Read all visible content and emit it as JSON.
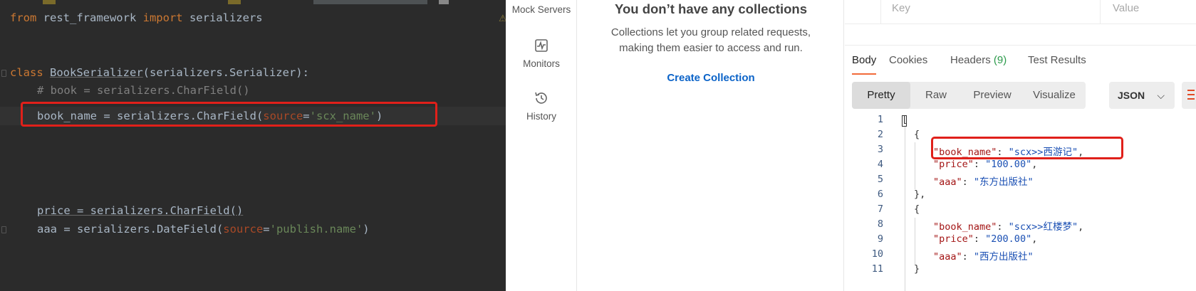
{
  "ide": {
    "code": {
      "line1": {
        "kw1": "from",
        "mod": " rest_framework ",
        "kw2": "import",
        "name": " serializers"
      },
      "line2": {
        "kw": "class",
        "name": "BookSerializer",
        "rest": "(serializers.Serializer):"
      },
      "line3": {
        "comment": "# book = serializers.CharField()"
      },
      "line4": {
        "pre": "book_name = serializers.CharField(",
        "param": "source",
        "eq": "=",
        "str": "'scx_name'",
        "post": ")"
      },
      "line5": {
        "text": "price = serializers.CharField()"
      },
      "line6": {
        "pre": "aaa = serializers.DateField(",
        "param": "source",
        "eq": "=",
        "str": "'publish.name'",
        "post": ")"
      }
    }
  },
  "sidebar": {
    "items": [
      {
        "label": "Mock Servers",
        "icon": "mock-servers-icon"
      },
      {
        "label": "Monitors",
        "icon": "monitor-icon"
      },
      {
        "label": "History",
        "icon": "history-icon"
      }
    ]
  },
  "collections": {
    "title": "You don’t have any collections",
    "description": "Collections let you group related requests, making them easier to access and run.",
    "create_label": "Create Collection"
  },
  "request": {
    "params": {
      "key_placeholder": "Key",
      "value_placeholder": "Value"
    }
  },
  "response": {
    "tabs": [
      {
        "label": "Body"
      },
      {
        "label": "Cookies"
      },
      {
        "label": "Headers",
        "count": "(9)"
      },
      {
        "label": "Test Results"
      }
    ],
    "views": [
      "Pretty",
      "Raw",
      "Preview",
      "Visualize"
    ],
    "format": "JSON",
    "line_numbers": [
      "1",
      "2",
      "3",
      "4",
      "5",
      "6",
      "7",
      "8",
      "9",
      "10",
      "11"
    ],
    "body": {
      "open_bracket": "[",
      "open_brace": "{",
      "close_brace_comma": "},",
      "close_brace": "}",
      "items": [
        {
          "book_name_key": "\"book_name\"",
          "book_name": "\"scx>>西游记\"",
          "price_key": "\"price\"",
          "price": "\"100.00\"",
          "aaa_key": "\"aaa\"",
          "aaa": "\"东方出版社\""
        },
        {
          "book_name_key": "\"book_name\"",
          "book_name": "\"scx>>红楼梦\"",
          "price_key": "\"price\"",
          "price": "\"200.00\"",
          "aaa_key": "\"aaa\"",
          "aaa": "\"西方出版社\""
        }
      ]
    }
  },
  "colors": {
    "highlight": "#e0201a",
    "accent": "#f26b3a",
    "link": "#0b63c8"
  }
}
